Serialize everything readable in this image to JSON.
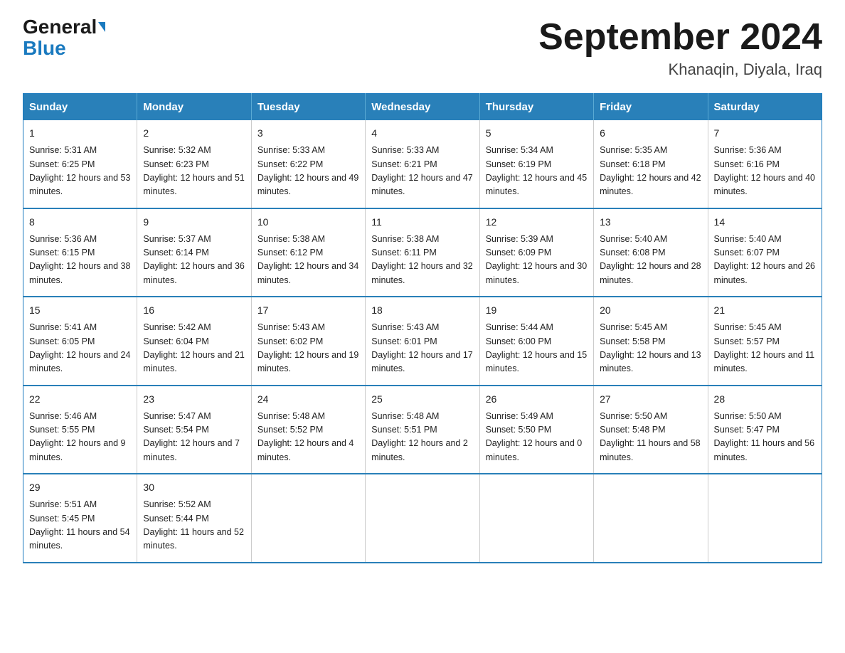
{
  "header": {
    "logo_line1": "General",
    "logo_line2": "Blue",
    "title": "September 2024",
    "subtitle": "Khanaqin, Diyala, Iraq"
  },
  "weekdays": [
    "Sunday",
    "Monday",
    "Tuesday",
    "Wednesday",
    "Thursday",
    "Friday",
    "Saturday"
  ],
  "weeks": [
    [
      {
        "day": "1",
        "sunrise": "Sunrise: 5:31 AM",
        "sunset": "Sunset: 6:25 PM",
        "daylight": "Daylight: 12 hours and 53 minutes."
      },
      {
        "day": "2",
        "sunrise": "Sunrise: 5:32 AM",
        "sunset": "Sunset: 6:23 PM",
        "daylight": "Daylight: 12 hours and 51 minutes."
      },
      {
        "day": "3",
        "sunrise": "Sunrise: 5:33 AM",
        "sunset": "Sunset: 6:22 PM",
        "daylight": "Daylight: 12 hours and 49 minutes."
      },
      {
        "day": "4",
        "sunrise": "Sunrise: 5:33 AM",
        "sunset": "Sunset: 6:21 PM",
        "daylight": "Daylight: 12 hours and 47 minutes."
      },
      {
        "day": "5",
        "sunrise": "Sunrise: 5:34 AM",
        "sunset": "Sunset: 6:19 PM",
        "daylight": "Daylight: 12 hours and 45 minutes."
      },
      {
        "day": "6",
        "sunrise": "Sunrise: 5:35 AM",
        "sunset": "Sunset: 6:18 PM",
        "daylight": "Daylight: 12 hours and 42 minutes."
      },
      {
        "day": "7",
        "sunrise": "Sunrise: 5:36 AM",
        "sunset": "Sunset: 6:16 PM",
        "daylight": "Daylight: 12 hours and 40 minutes."
      }
    ],
    [
      {
        "day": "8",
        "sunrise": "Sunrise: 5:36 AM",
        "sunset": "Sunset: 6:15 PM",
        "daylight": "Daylight: 12 hours and 38 minutes."
      },
      {
        "day": "9",
        "sunrise": "Sunrise: 5:37 AM",
        "sunset": "Sunset: 6:14 PM",
        "daylight": "Daylight: 12 hours and 36 minutes."
      },
      {
        "day": "10",
        "sunrise": "Sunrise: 5:38 AM",
        "sunset": "Sunset: 6:12 PM",
        "daylight": "Daylight: 12 hours and 34 minutes."
      },
      {
        "day": "11",
        "sunrise": "Sunrise: 5:38 AM",
        "sunset": "Sunset: 6:11 PM",
        "daylight": "Daylight: 12 hours and 32 minutes."
      },
      {
        "day": "12",
        "sunrise": "Sunrise: 5:39 AM",
        "sunset": "Sunset: 6:09 PM",
        "daylight": "Daylight: 12 hours and 30 minutes."
      },
      {
        "day": "13",
        "sunrise": "Sunrise: 5:40 AM",
        "sunset": "Sunset: 6:08 PM",
        "daylight": "Daylight: 12 hours and 28 minutes."
      },
      {
        "day": "14",
        "sunrise": "Sunrise: 5:40 AM",
        "sunset": "Sunset: 6:07 PM",
        "daylight": "Daylight: 12 hours and 26 minutes."
      }
    ],
    [
      {
        "day": "15",
        "sunrise": "Sunrise: 5:41 AM",
        "sunset": "Sunset: 6:05 PM",
        "daylight": "Daylight: 12 hours and 24 minutes."
      },
      {
        "day": "16",
        "sunrise": "Sunrise: 5:42 AM",
        "sunset": "Sunset: 6:04 PM",
        "daylight": "Daylight: 12 hours and 21 minutes."
      },
      {
        "day": "17",
        "sunrise": "Sunrise: 5:43 AM",
        "sunset": "Sunset: 6:02 PM",
        "daylight": "Daylight: 12 hours and 19 minutes."
      },
      {
        "day": "18",
        "sunrise": "Sunrise: 5:43 AM",
        "sunset": "Sunset: 6:01 PM",
        "daylight": "Daylight: 12 hours and 17 minutes."
      },
      {
        "day": "19",
        "sunrise": "Sunrise: 5:44 AM",
        "sunset": "Sunset: 6:00 PM",
        "daylight": "Daylight: 12 hours and 15 minutes."
      },
      {
        "day": "20",
        "sunrise": "Sunrise: 5:45 AM",
        "sunset": "Sunset: 5:58 PM",
        "daylight": "Daylight: 12 hours and 13 minutes."
      },
      {
        "day": "21",
        "sunrise": "Sunrise: 5:45 AM",
        "sunset": "Sunset: 5:57 PM",
        "daylight": "Daylight: 12 hours and 11 minutes."
      }
    ],
    [
      {
        "day": "22",
        "sunrise": "Sunrise: 5:46 AM",
        "sunset": "Sunset: 5:55 PM",
        "daylight": "Daylight: 12 hours and 9 minutes."
      },
      {
        "day": "23",
        "sunrise": "Sunrise: 5:47 AM",
        "sunset": "Sunset: 5:54 PM",
        "daylight": "Daylight: 12 hours and 7 minutes."
      },
      {
        "day": "24",
        "sunrise": "Sunrise: 5:48 AM",
        "sunset": "Sunset: 5:52 PM",
        "daylight": "Daylight: 12 hours and 4 minutes."
      },
      {
        "day": "25",
        "sunrise": "Sunrise: 5:48 AM",
        "sunset": "Sunset: 5:51 PM",
        "daylight": "Daylight: 12 hours and 2 minutes."
      },
      {
        "day": "26",
        "sunrise": "Sunrise: 5:49 AM",
        "sunset": "Sunset: 5:50 PM",
        "daylight": "Daylight: 12 hours and 0 minutes."
      },
      {
        "day": "27",
        "sunrise": "Sunrise: 5:50 AM",
        "sunset": "Sunset: 5:48 PM",
        "daylight": "Daylight: 11 hours and 58 minutes."
      },
      {
        "day": "28",
        "sunrise": "Sunrise: 5:50 AM",
        "sunset": "Sunset: 5:47 PM",
        "daylight": "Daylight: 11 hours and 56 minutes."
      }
    ],
    [
      {
        "day": "29",
        "sunrise": "Sunrise: 5:51 AM",
        "sunset": "Sunset: 5:45 PM",
        "daylight": "Daylight: 11 hours and 54 minutes."
      },
      {
        "day": "30",
        "sunrise": "Sunrise: 5:52 AM",
        "sunset": "Sunset: 5:44 PM",
        "daylight": "Daylight: 11 hours and 52 minutes."
      },
      null,
      null,
      null,
      null,
      null
    ]
  ]
}
